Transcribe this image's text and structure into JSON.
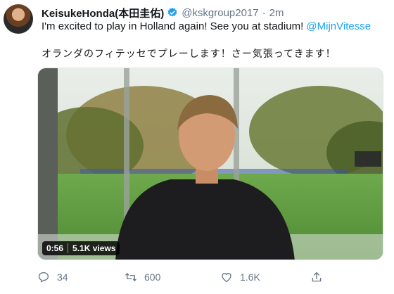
{
  "tweet": {
    "display_name": "KeisukeHonda(本田圭佑)",
    "handle": "@kskgroup2017",
    "separator": "·",
    "time": "2m",
    "text_before_mention": "I'm excited to play in Holland again! See you at stadium! ",
    "mention": "@MijnVitesse",
    "text_japanese": "オランダのフィテッセでプレーします！さー気張ってきます！"
  },
  "video": {
    "duration": "0:56",
    "views": "5.1K views"
  },
  "actions": {
    "reply_count": "34",
    "retweet_count": "600",
    "like_count": "1.6K"
  },
  "colors": {
    "verified": "#1da1f2",
    "link": "#1da1f2",
    "secondary_text": "#657786"
  },
  "icons": [
    "verified-icon",
    "reply-icon",
    "retweet-icon",
    "like-icon",
    "share-icon"
  ]
}
